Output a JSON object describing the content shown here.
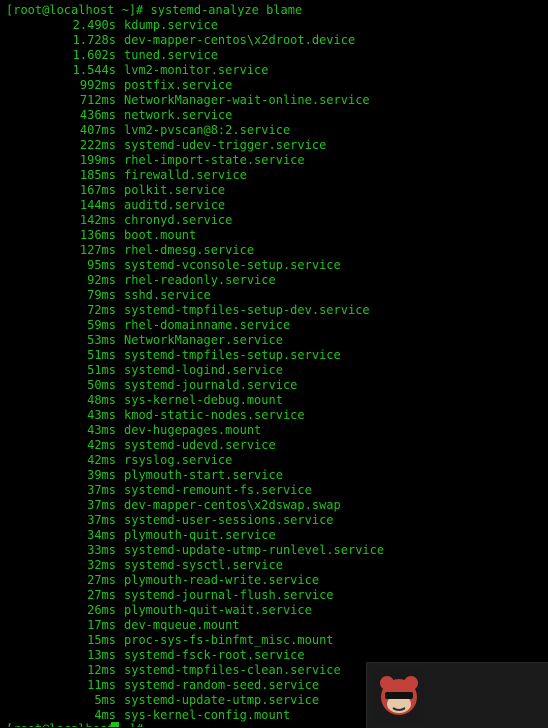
{
  "prompt": "[root@localhost ~]# systemd-analyze blame",
  "bottom_prompt": "[root@localhost ~]# ",
  "rows": [
    {
      "time": "2.490s",
      "unit": "kdump.service"
    },
    {
      "time": "1.728s",
      "unit": "dev-mapper-centos\\x2droot.device"
    },
    {
      "time": "1.602s",
      "unit": "tuned.service"
    },
    {
      "time": "1.544s",
      "unit": "lvm2-monitor.service"
    },
    {
      "time": "992ms",
      "unit": "postfix.service"
    },
    {
      "time": "712ms",
      "unit": "NetworkManager-wait-online.service"
    },
    {
      "time": "436ms",
      "unit": "network.service"
    },
    {
      "time": "407ms",
      "unit": "lvm2-pvscan@8:2.service"
    },
    {
      "time": "222ms",
      "unit": "systemd-udev-trigger.service"
    },
    {
      "time": "199ms",
      "unit": "rhel-import-state.service"
    },
    {
      "time": "185ms",
      "unit": "firewalld.service"
    },
    {
      "time": "167ms",
      "unit": "polkit.service"
    },
    {
      "time": "144ms",
      "unit": "auditd.service"
    },
    {
      "time": "142ms",
      "unit": "chronyd.service"
    },
    {
      "time": "136ms",
      "unit": "boot.mount"
    },
    {
      "time": "127ms",
      "unit": "rhel-dmesg.service"
    },
    {
      "time": "95ms",
      "unit": "systemd-vconsole-setup.service"
    },
    {
      "time": "92ms",
      "unit": "rhel-readonly.service"
    },
    {
      "time": "79ms",
      "unit": "sshd.service"
    },
    {
      "time": "72ms",
      "unit": "systemd-tmpfiles-setup-dev.service"
    },
    {
      "time": "59ms",
      "unit": "rhel-domainname.service"
    },
    {
      "time": "53ms",
      "unit": "NetworkManager.service"
    },
    {
      "time": "51ms",
      "unit": "systemd-tmpfiles-setup.service"
    },
    {
      "time": "51ms",
      "unit": "systemd-logind.service"
    },
    {
      "time": "50ms",
      "unit": "systemd-journald.service"
    },
    {
      "time": "48ms",
      "unit": "sys-kernel-debug.mount"
    },
    {
      "time": "43ms",
      "unit": "kmod-static-nodes.service"
    },
    {
      "time": "43ms",
      "unit": "dev-hugepages.mount"
    },
    {
      "time": "42ms",
      "unit": "systemd-udevd.service"
    },
    {
      "time": "42ms",
      "unit": "rsyslog.service"
    },
    {
      "time": "39ms",
      "unit": "plymouth-start.service"
    },
    {
      "time": "37ms",
      "unit": "systemd-remount-fs.service"
    },
    {
      "time": "37ms",
      "unit": "dev-mapper-centos\\x2dswap.swap"
    },
    {
      "time": "37ms",
      "unit": "systemd-user-sessions.service"
    },
    {
      "time": "34ms",
      "unit": "plymouth-quit.service"
    },
    {
      "time": "33ms",
      "unit": "systemd-update-utmp-runlevel.service"
    },
    {
      "time": "32ms",
      "unit": "systemd-sysctl.service"
    },
    {
      "time": "27ms",
      "unit": "plymouth-read-write.service"
    },
    {
      "time": "27ms",
      "unit": "systemd-journal-flush.service"
    },
    {
      "time": "26ms",
      "unit": "plymouth-quit-wait.service"
    },
    {
      "time": "17ms",
      "unit": "dev-mqueue.mount"
    },
    {
      "time": "15ms",
      "unit": "proc-sys-fs-binfmt_misc.mount"
    },
    {
      "time": "13ms",
      "unit": "systemd-fsck-root.service"
    },
    {
      "time": "12ms",
      "unit": "systemd-tmpfiles-clean.service"
    },
    {
      "time": "11ms",
      "unit": "systemd-random-seed.service"
    },
    {
      "time": "5ms",
      "unit": "systemd-update-utmp.service"
    },
    {
      "time": "4ms",
      "unit": "sys-kernel-config.mount"
    }
  ],
  "colors": {
    "foreground": "#22c21e",
    "background": "#000000",
    "overlay": "#1b1b1b"
  },
  "overlay": {
    "avatar_icon": "avatar-icon"
  }
}
